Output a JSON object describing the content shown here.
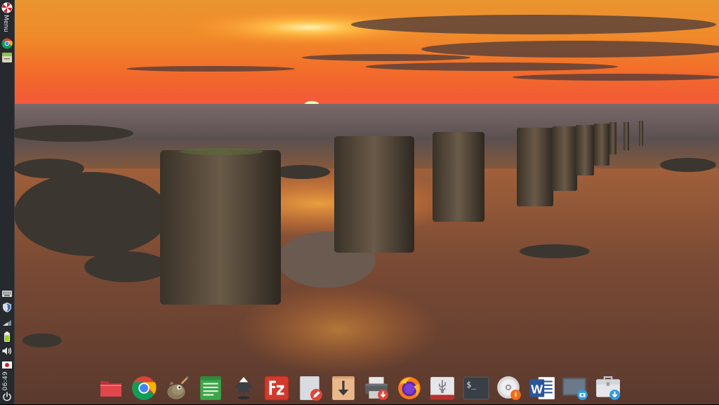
{
  "panel": {
    "menu_label": "Menu",
    "clock": "06:49",
    "launchers": [
      {
        "icon": "chrome-icon"
      },
      {
        "icon": "file-manager-icon"
      }
    ],
    "tray": [
      {
        "icon": "keyboard-icon"
      },
      {
        "icon": "shield-update-icon"
      },
      {
        "icon": "network-icon"
      },
      {
        "icon": "battery-icon"
      },
      {
        "icon": "volume-icon"
      },
      {
        "icon": "japanese-flag-icon"
      }
    ]
  },
  "dock": {
    "items": [
      {
        "icon": "folder-icon",
        "color": "#e0464c"
      },
      {
        "icon": "chrome-icon"
      },
      {
        "icon": "gimp-icon"
      },
      {
        "icon": "text-editor-icon",
        "color": "#3aa64a"
      },
      {
        "icon": "inkscape-icon"
      },
      {
        "icon": "filezilla-icon",
        "color": "#d33a2c"
      },
      {
        "icon": "document-edit-icon"
      },
      {
        "icon": "download-icon",
        "color": "#e9b98b"
      },
      {
        "icon": "printer-icon"
      },
      {
        "icon": "firefox-icon"
      },
      {
        "icon": "usb-creator-icon"
      },
      {
        "icon": "terminal-icon",
        "text": "$_"
      },
      {
        "icon": "disc-burner-icon"
      },
      {
        "icon": "word-icon",
        "text": "W"
      },
      {
        "icon": "screenshot-icon"
      },
      {
        "icon": "package-installer-icon"
      }
    ]
  }
}
